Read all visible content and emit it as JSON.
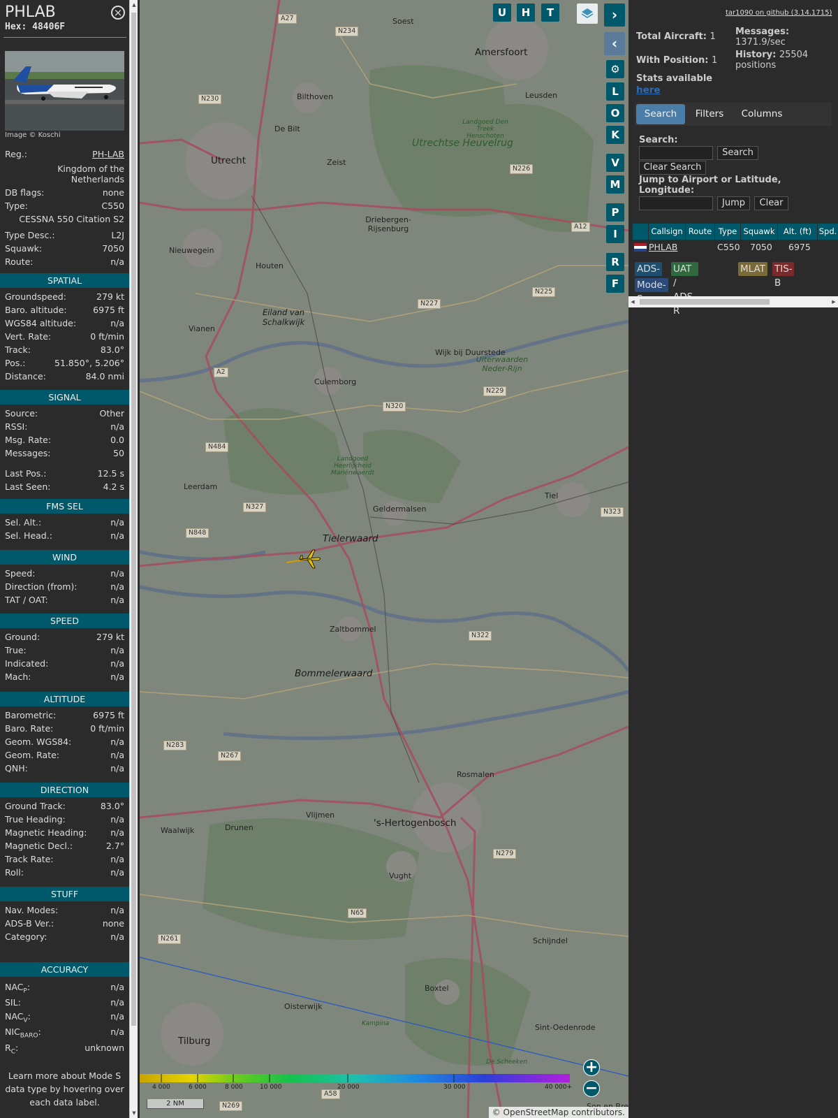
{
  "info_panel": {
    "callsign": "PHLAB",
    "hex": "Hex: 48406F",
    "image_credit": "Image © Koschi",
    "registration": {
      "label": "Reg.:",
      "value": "PH-LAB"
    },
    "country": "Kingdom of the Netherlands",
    "db_flags": {
      "label": "DB flags:",
      "value": "none"
    },
    "type": {
      "label": "Type:",
      "value": "C550"
    },
    "type_full": "CESSNA 550 Citation S2",
    "type_desc": {
      "label": "Type Desc.:",
      "value": "L2J"
    },
    "squawk": {
      "label": "Squawk:",
      "value": "7050"
    },
    "route": {
      "label": "Route:",
      "value": "n/a"
    },
    "sections": {
      "spatial": "SPATIAL",
      "signal": "SIGNAL",
      "fms": "FMS SEL",
      "wind": "WIND",
      "speed": "SPEED",
      "altitude": "ALTITUDE",
      "direction": "DIRECTION",
      "stuff": "STUFF",
      "accuracy": "ACCURACY"
    },
    "spatial": [
      {
        "label": "Groundspeed:",
        "value": "279 kt"
      },
      {
        "label": "Baro. altitude:",
        "value": "6975 ft"
      },
      {
        "label": "WGS84 altitude:",
        "value": "n/a"
      },
      {
        "label": "Vert. Rate:",
        "value": "0 ft/min"
      },
      {
        "label": "Track:",
        "value": "83.0°"
      },
      {
        "label": "Pos.:",
        "value": "51.850°, 5.206°"
      },
      {
        "label": "Distance:",
        "value": "84.0 nmi"
      }
    ],
    "signal": [
      {
        "label": "Source:",
        "value": "Other"
      },
      {
        "label": "RSSI:",
        "value": "n/a"
      },
      {
        "label": "Msg. Rate:",
        "value": "0.0"
      },
      {
        "label": "Messages:",
        "value": "50"
      }
    ],
    "signal2": [
      {
        "label": "Last Pos.:",
        "value": "12.5 s"
      },
      {
        "label": "Last Seen:",
        "value": "4.2 s"
      }
    ],
    "fms": [
      {
        "label": "Sel. Alt.:",
        "value": "n/a"
      },
      {
        "label": "Sel. Head.:",
        "value": "n/a"
      }
    ],
    "wind": [
      {
        "label": "Speed:",
        "value": "n/a"
      },
      {
        "label": "Direction (from):",
        "value": "n/a"
      },
      {
        "label": "TAT / OAT:",
        "value": "n/a"
      }
    ],
    "speed": [
      {
        "label": "Ground:",
        "value": "279 kt"
      },
      {
        "label": "True:",
        "value": "n/a"
      },
      {
        "label": "Indicated:",
        "value": "n/a"
      },
      {
        "label": "Mach:",
        "value": "n/a"
      }
    ],
    "altitude": [
      {
        "label": "Barometric:",
        "value": "6975 ft"
      },
      {
        "label": "Baro. Rate:",
        "value": "0 ft/min"
      },
      {
        "label": "Geom. WGS84:",
        "value": "n/a"
      },
      {
        "label": "Geom. Rate:",
        "value": "n/a"
      },
      {
        "label": "QNH:",
        "value": "n/a"
      }
    ],
    "direction": [
      {
        "label": "Ground Track:",
        "value": "83.0°"
      },
      {
        "label": "True Heading:",
        "value": "n/a"
      },
      {
        "label": "Magnetic Heading:",
        "value": "n/a"
      },
      {
        "label": "Magnetic Decl.:",
        "value": "2.7°"
      },
      {
        "label": "Track Rate:",
        "value": "n/a"
      },
      {
        "label": "Roll:",
        "value": "n/a"
      }
    ],
    "stuff": [
      {
        "label": "Nav. Modes:",
        "value": "n/a"
      },
      {
        "label": "ADS-B Ver.:",
        "value": "none"
      },
      {
        "label": "Category:",
        "value": "n/a"
      }
    ],
    "accuracy": [
      {
        "label": "NAC",
        "sub": "P",
        "value": "n/a"
      },
      {
        "label": "SIL:",
        "sub": "",
        "value": "n/a"
      },
      {
        "label": "NAC",
        "sub": "V",
        "value": "n/a"
      },
      {
        "label": "NIC",
        "sub": "BARO",
        "value": "n/a"
      },
      {
        "label": "R",
        "sub": "C",
        "value": "unknown"
      }
    ],
    "footer": "Learn more about Mode S data type by hovering over each data label."
  },
  "map": {
    "buttons": {
      "u": "U",
      "h": "H",
      "t": "T",
      "l": "L",
      "o": "O",
      "k": "K",
      "v": "V",
      "m": "M",
      "p": "P",
      "i": "I",
      "r": "R",
      "f": "F"
    },
    "places": [
      "Soest",
      "Amersfoort",
      "Leusden",
      "Bilthoven",
      "De Bilt",
      "Utrecht",
      "Zeist",
      "Utrechtse Heuvelrug",
      "Driebergen-Rijsenburg",
      "Nieuwegein",
      "Houten",
      "Eiland van Schalkwijk",
      "Vianen",
      "Wijk bij Duurstede",
      "Uiterwaarden Neder-Rijn",
      "Culemborg",
      "Landgoed Heerlijkheid Mariënwaerdt",
      "Leerdam",
      "Geldermalsen",
      "Tiel",
      "Tielerwaard",
      "Zaltbommel",
      "Bommelerwaard",
      "Rosmalen",
      "'s-Hertogenbosch",
      "Vlijmen",
      "Drunen",
      "Waalwijk",
      "Vught",
      "Schijndel",
      "Boxtel",
      "Oisterwijk",
      "Tilburg",
      "Sint-Oedenrode",
      "Landgoed Den Treek Henschoten",
      "Kampina",
      "De Scheeken",
      "Son en Breu"
    ],
    "roads": [
      "A27",
      "N234",
      "N230",
      "N226",
      "A12",
      "N225",
      "N227",
      "A2",
      "N229",
      "N320",
      "N484",
      "N327",
      "N848",
      "N323",
      "N322",
      "N283",
      "N267",
      "N279",
      "N65",
      "N261",
      "A58",
      "N269"
    ],
    "altitude_scale": [
      "4 000",
      "6 000",
      "8 000",
      "10 000",
      "20 000",
      "30 000",
      "40 000+"
    ],
    "scale_text": "2 NM",
    "attribution": "© OpenStreetMap contributors.",
    "zoom_in": "+",
    "zoom_out": "−"
  },
  "sidebar": {
    "version_link": "tar1090 on github (3.14.1715)",
    "total_aircraft": {
      "label": "Total Aircraft:",
      "value": "1"
    },
    "with_position": {
      "label": "With Position:",
      "value": "1"
    },
    "messages": {
      "label": "Messages:",
      "value": "1371.9/sec"
    },
    "history": {
      "label": "History:",
      "value": "25504 positions"
    },
    "stats_available": "Stats available",
    "stats_link": "here",
    "tabs": [
      "Search",
      "Filters",
      "Columns"
    ],
    "search_label": "Search:",
    "search_button": "Search",
    "clear_search_button": "Clear Search",
    "jump_label": "Jump to Airport or Latitude, Longitude:",
    "jump_button": "Jump",
    "clear_button": "Clear",
    "table_headers": [
      "Callsign",
      "Route",
      "Type",
      "Squawk",
      "Alt. (ft)",
      "Spd."
    ],
    "table_rows": [
      {
        "callsign": "PHLAB",
        "route": "",
        "type": "C550",
        "squawk": "7050",
        "alt": "6975"
      }
    ],
    "source_tags": [
      "ADS-B",
      "UAT / ADS-R",
      "MLAT",
      "TIS-B",
      "Mode-S"
    ],
    "colors": {
      "adsb": "#1e4f6e",
      "uat": "#2e6a3e",
      "mlat": "#7a6a3a",
      "tisb": "#7a2a2a",
      "modes": "#2a4a7a"
    }
  }
}
